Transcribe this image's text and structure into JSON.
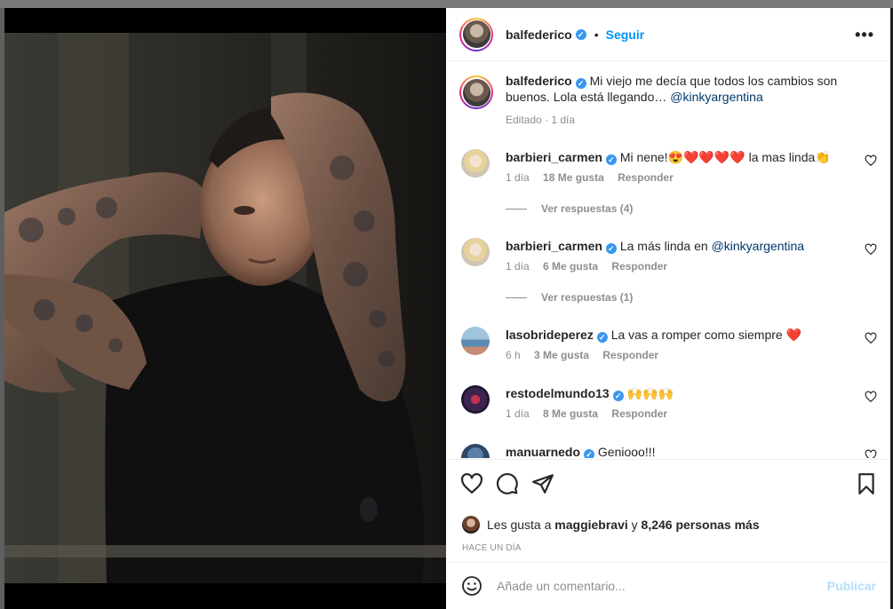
{
  "post": {
    "username": "balfederico",
    "verified_mark": "✓",
    "separator": "•",
    "follow_label": "Seguir",
    "more_label": "•••"
  },
  "caption": {
    "username": "balfederico",
    "text": "Mi viejo me decía que todos los cambios son buenos. Lola está llegando…",
    "mention": "@kinkyargentina",
    "meta": "Editado · 1 día"
  },
  "comments": [
    {
      "username": "barbieri_carmen",
      "text": "Mi nene!😍❤️❤️❤️❤️ la mas linda👏",
      "time": "1 día",
      "likes": "18 Me gusta",
      "reply": "Responder",
      "replies": "Ver respuestas (4)"
    },
    {
      "username": "barbieri_carmen",
      "text": "La más linda en ",
      "mention": "@kinkyargentina",
      "time": "1 día",
      "likes": "6 Me gusta",
      "reply": "Responder",
      "replies": "Ver respuestas (1)"
    },
    {
      "username": "lasobrideperez",
      "text": "La vas a romper como siempre ❤️",
      "time": "6 h",
      "likes": "3 Me gusta",
      "reply": "Responder"
    },
    {
      "username": "restodelmundo13",
      "text": "🙌🙌🙌",
      "time": "1 día",
      "likes": "8 Me gusta",
      "reply": "Responder"
    },
    {
      "username": "manuarnedo",
      "text": "Geniooo!!!"
    }
  ],
  "likes": {
    "prefix": "Les gusta a ",
    "user": "maggiebravi",
    "middle": " y ",
    "count": "8,246 personas más"
  },
  "time_ago": "HACE UN DÍA",
  "add_comment": {
    "placeholder": "Añade un comentario...",
    "publish_label": "Publicar"
  },
  "colors": {
    "accent": "#0095f6",
    "publish_disabled": "#b2dffc",
    "verified": "#3897f0",
    "heart": "#ed4956"
  },
  "icons": [
    "heart-icon",
    "comment-icon",
    "share-icon",
    "bookmark-icon",
    "emoji-icon",
    "more-icon",
    "verified-icon"
  ]
}
